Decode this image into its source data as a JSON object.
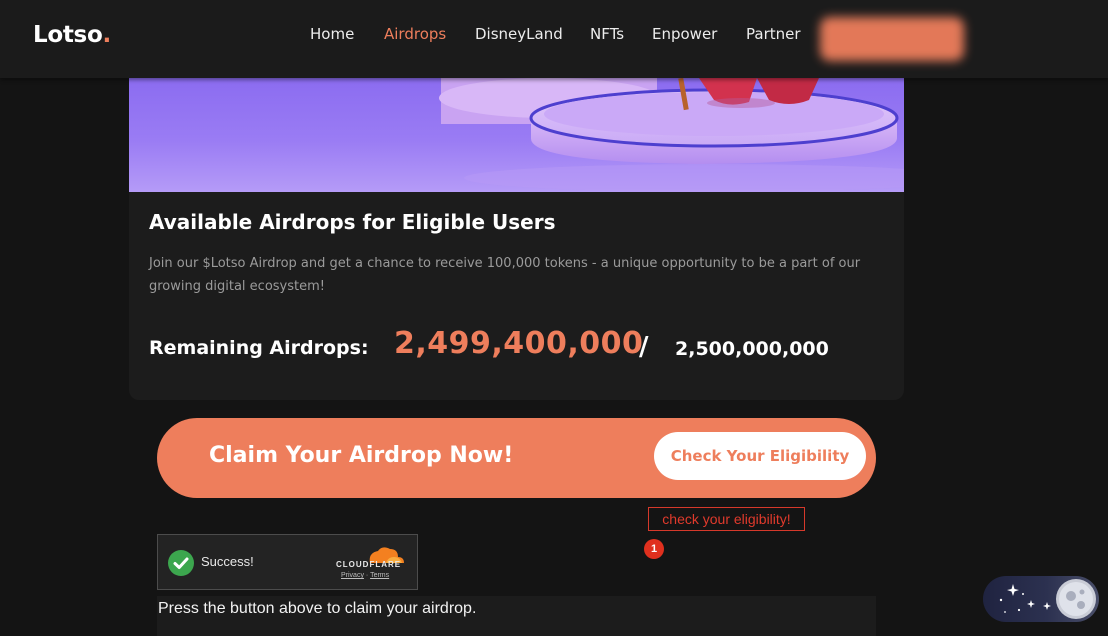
{
  "brand": {
    "name": "Lotso",
    "dot": "."
  },
  "nav": {
    "items": [
      {
        "label": "Home",
        "active": false
      },
      {
        "label": "Airdrops",
        "active": true
      },
      {
        "label": "DisneyLand",
        "active": false
      },
      {
        "label": "NFTs",
        "active": false
      },
      {
        "label": "Enpower",
        "active": false
      },
      {
        "label": "Partner",
        "active": false
      }
    ]
  },
  "airdrop": {
    "title": "Available Airdrops for Eligible Users",
    "description": "Join our $Lotso Airdrop and get a chance to receive 100,000 tokens - a unique opportunity to be a part of our growing digital ecosystem!",
    "remaining_label": "Remaining Airdrops:",
    "remaining_value": "2,499,400,000",
    "separator": "/",
    "total": "2,500,000,000"
  },
  "claim": {
    "heading": "Claim Your Airdrop Now!",
    "button_label": "Check Your Eligibility"
  },
  "annotation": {
    "label": "check your eligibility!",
    "badge": "1"
  },
  "turnstile": {
    "status": "Success!",
    "brand": "CLOUDFLARE",
    "privacy": "Privacy",
    "separator": "·",
    "terms": "Terms"
  },
  "instruction": "Press the button above to claim your airdrop.",
  "colors": {
    "accent": "#ee7e5c",
    "background": "#141414",
    "card": "#1c1c1c",
    "success": "#3ca64e",
    "annotation": "#e0301e"
  },
  "icons": {
    "success": "check-circle-icon",
    "cloudflare": "cloudflare-logo-icon",
    "theme": "moon-icon"
  }
}
